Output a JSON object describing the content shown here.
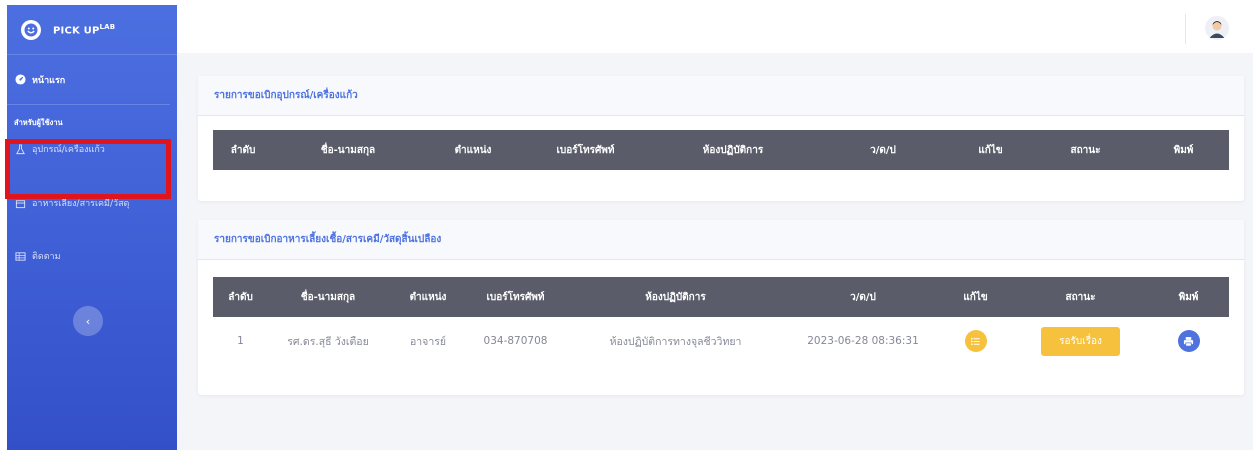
{
  "brand": {
    "name": "PICK UP",
    "sup": "LAB"
  },
  "sidebar": {
    "home_label": "หน้าแรก",
    "section_heading": "สำหรับผู้ใช้งาน",
    "items": [
      {
        "label": "อุปกรณ์/เครื่องแก้ว",
        "icon": "flask-icon"
      },
      {
        "label": "อาหารเลี้ยง/สารเคมี/วัสดุ",
        "icon": "box-icon"
      },
      {
        "label": "ติดตาม",
        "icon": "table-icon"
      }
    ],
    "collapse_glyph": "‹"
  },
  "card1": {
    "title": "รายการขอเบิกอุปกรณ์/เครื่องแก้ว",
    "columns": [
      "ลำดับ",
      "ชื่อ-นามสกุล",
      "ตำแหน่ง",
      "เบอร์โทรศัพท์",
      "ห้องปฏิบัติการ",
      "ว/ด/ป",
      "แก้ไข",
      "สถานะ",
      "พิมพ์"
    ]
  },
  "card2": {
    "title": "รายการขอเบิกอาหารเลี้ยงเชื้อ/สารเคมี/วัสดุสิ้นเปลือง",
    "columns": [
      "ลำดับ",
      "ชื่อ-นามสกุล",
      "ตำแหน่ง",
      "เบอร์โทรศัพท์",
      "ห้องปฏิบัติการ",
      "ว/ด/ป",
      "แก้ไข",
      "สถานะ",
      "พิมพ์"
    ],
    "rows": [
      {
        "no": "1",
        "name": "รศ.ดร.สุธี วังเตือย",
        "position": "อาจารย์",
        "phone": "034-870708",
        "lab": "ห้องปฏิบัติการทางจุลชีววิทยา",
        "date": "2023-06-28 08:36:31",
        "status": "รอรับเรื่อง"
      }
    ]
  },
  "colors": {
    "primary": "#4e73df",
    "warning": "#f6c23e",
    "table_head": "#5a5c69",
    "highlight": "#e0141c"
  }
}
